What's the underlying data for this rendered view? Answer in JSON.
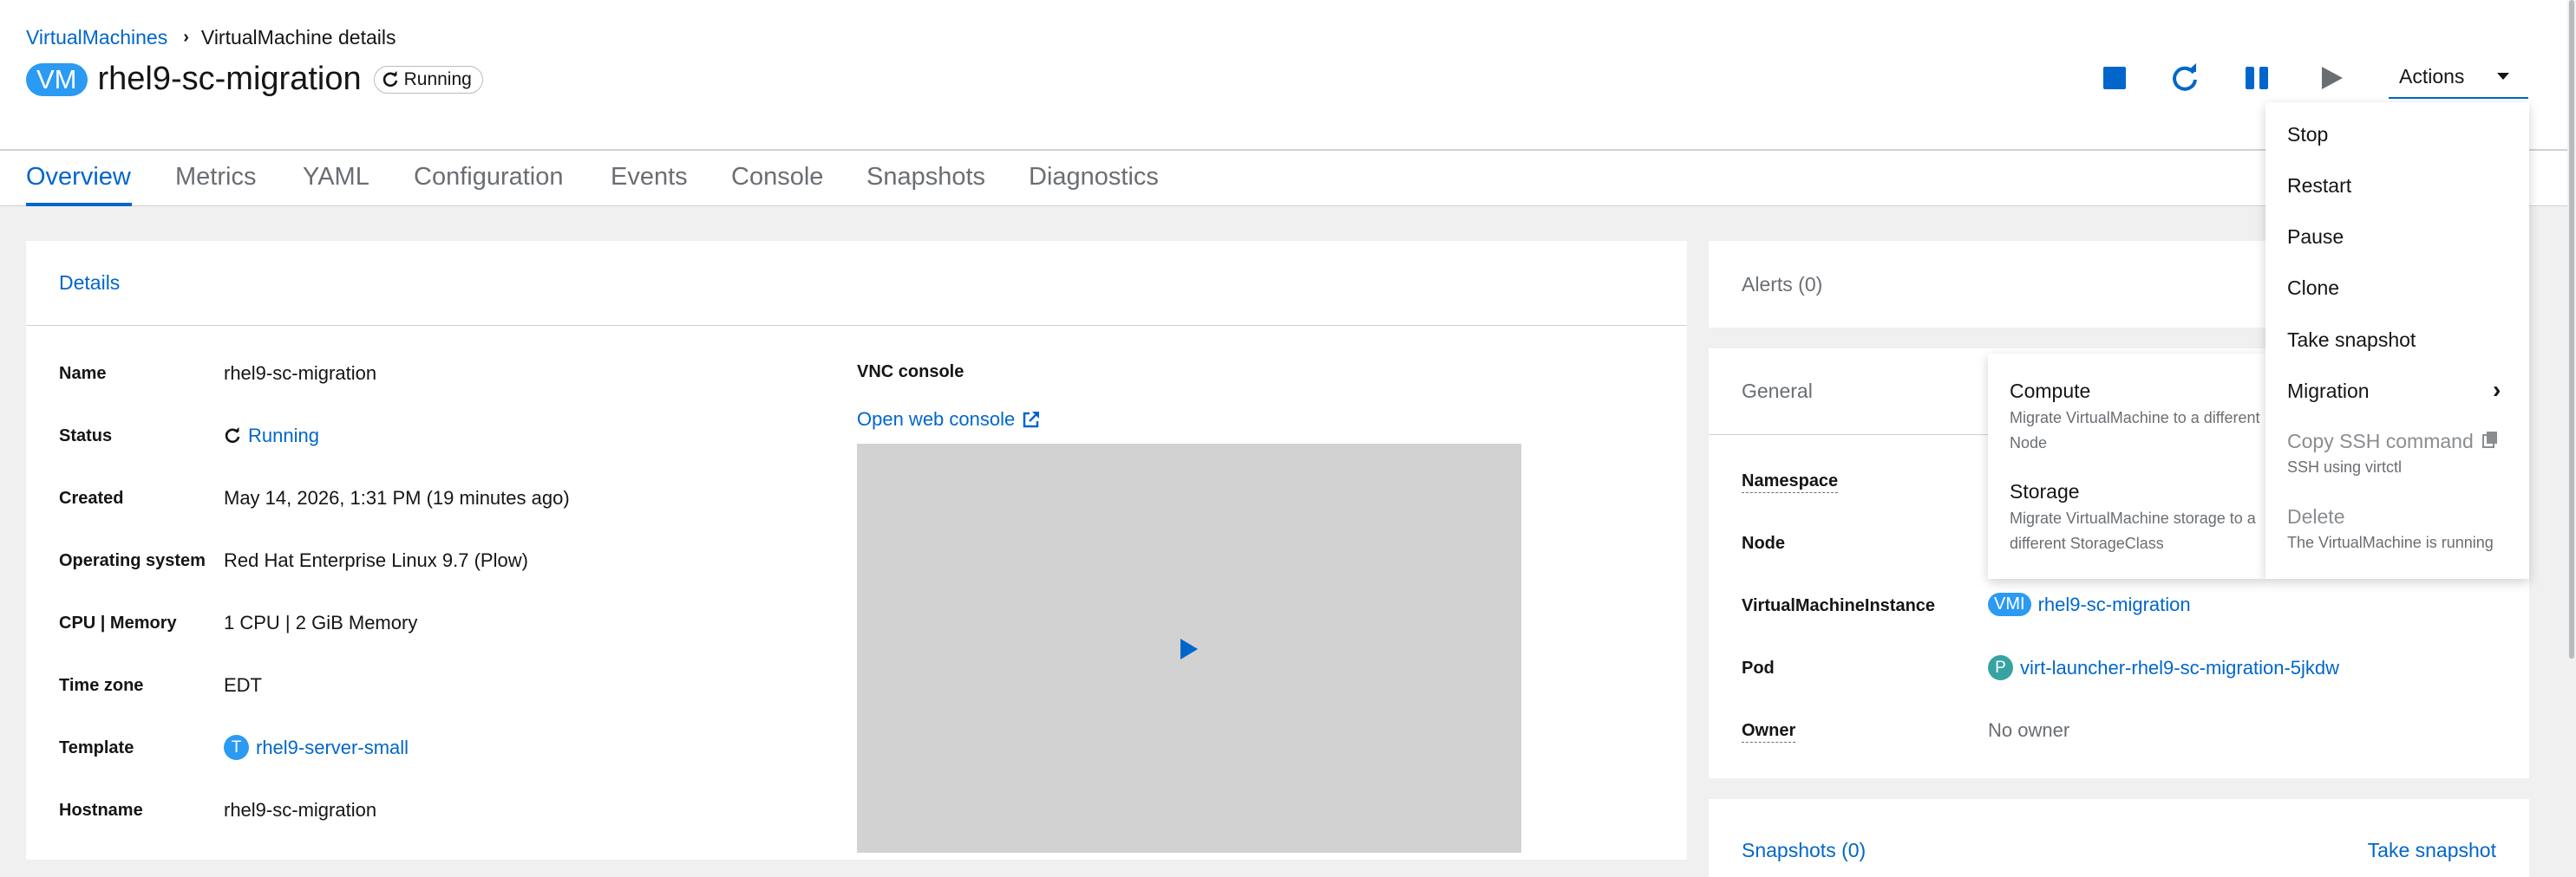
{
  "breadcrumb": {
    "parent": "VirtualMachines",
    "current": "VirtualMachine details"
  },
  "vm": {
    "badge": "VM",
    "name": "rhel9-sc-migration",
    "status": "Running"
  },
  "toolbar": {
    "stop_icon": "stop-icon",
    "restart_icon": "restart-icon",
    "pause_icon": "pause-icon",
    "start_icon": "play-icon",
    "actions_label": "Actions"
  },
  "tabs": [
    {
      "label": "Overview",
      "active": true
    },
    {
      "label": "Metrics"
    },
    {
      "label": "YAML"
    },
    {
      "label": "Configuration"
    },
    {
      "label": "Events"
    },
    {
      "label": "Console"
    },
    {
      "label": "Snapshots"
    },
    {
      "label": "Diagnostics"
    }
  ],
  "details": {
    "heading": "Details",
    "rows": [
      {
        "label": "Name",
        "value": "rhel9-sc-migration"
      },
      {
        "label": "Status",
        "value": "Running"
      },
      {
        "label": "Created",
        "value": "May 14, 2026, 1:31 PM (19 minutes ago)"
      },
      {
        "label": "Operating system",
        "value": "Red Hat Enterprise Linux 9.7 (Plow)"
      },
      {
        "label": "CPU | Memory",
        "value": "1 CPU | 2 GiB Memory"
      },
      {
        "label": "Time zone",
        "value": "EDT"
      },
      {
        "label": "Template",
        "badge": "T",
        "value": "rhel9-server-small"
      },
      {
        "label": "Hostname",
        "value": "rhel9-sc-migration"
      }
    ],
    "vnc_label": "VNC console",
    "vnc_link": "Open web console"
  },
  "alerts": {
    "heading": "Alerts (0)"
  },
  "general": {
    "heading": "General",
    "rows": [
      {
        "label": "Namespace",
        "value": ""
      },
      {
        "label": "Node",
        "value": ""
      },
      {
        "label": "VirtualMachineInstance",
        "badge": "VMI",
        "value": "rhel9-sc-migration"
      },
      {
        "label": "Pod",
        "badge": "P",
        "value": "virt-launcher-rhel9-sc-migration-5jkdw"
      },
      {
        "label": "Owner",
        "value": "No owner"
      }
    ]
  },
  "snapshots": {
    "heading": "Snapshots (0)",
    "action": "Take snapshot"
  },
  "actions_menu": {
    "items": [
      {
        "label": "Stop"
      },
      {
        "label": "Restart"
      },
      {
        "label": "Pause"
      },
      {
        "label": "Clone"
      },
      {
        "label": "Take snapshot"
      },
      {
        "label": "Migration"
      },
      {
        "label": "Copy SSH command",
        "desc": "SSH using virtctl",
        "disabled": true
      },
      {
        "label": "Delete",
        "desc": "The VirtualMachine is running",
        "disabled": true
      }
    ]
  },
  "migration_submenu": {
    "items": [
      {
        "label": "Compute",
        "desc": "Migrate VirtualMachine to a different Node"
      },
      {
        "label": "Storage",
        "desc": "Migrate VirtualMachine storage to a different StorageClass"
      }
    ]
  },
  "colors": {
    "accent": "#0066cc",
    "badge_blue": "#2b9af3",
    "badge_teal": "#37a3a3",
    "vnc_bg": "#d2d2d2"
  }
}
